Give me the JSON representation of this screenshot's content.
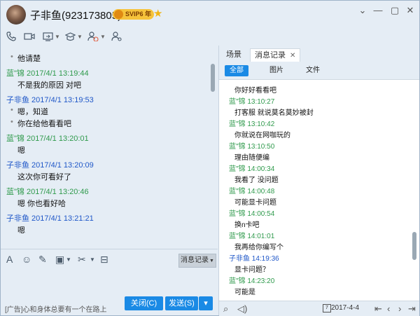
{
  "window": {
    "title": "子非鱼(923173805)",
    "svip_badge": "SVIP6 年",
    "controls": [
      "⌄",
      "—",
      "▢",
      "✕"
    ]
  },
  "toolbar": {
    "icons": [
      "phone-icon",
      "video-icon",
      "screen-share-icon",
      "app-center-icon",
      "add-contact-icon",
      "more-user-icon"
    ]
  },
  "chat": {
    "messages": [
      {
        "type": "body",
        "text": "他请楚",
        "dot": true
      },
      {
        "type": "head",
        "color": "green",
        "text": "蓝\"锦 2017/4/1 13:19:44"
      },
      {
        "type": "body",
        "text": "不是我的原因 对吧",
        "dot": false
      },
      {
        "type": "head",
        "color": "blue",
        "text": "子非鱼 2017/4/1 13:19:53"
      },
      {
        "type": "body",
        "text": "嗯，知道",
        "dot": true
      },
      {
        "type": "body",
        "text": "你在给他看看吧",
        "dot": true
      },
      {
        "type": "head",
        "color": "green",
        "text": "蓝\"锦 2017/4/1 13:20:01"
      },
      {
        "type": "body",
        "text": "嗯",
        "dot": false
      },
      {
        "type": "head",
        "color": "blue",
        "text": "子非鱼 2017/4/1 13:20:09"
      },
      {
        "type": "body",
        "text": "这次你可看好了",
        "dot": false
      },
      {
        "type": "head",
        "color": "green",
        "text": "蓝\"锦 2017/4/1 13:20:46"
      },
      {
        "type": "body",
        "text": "嗯 你也看好哈",
        "dot": false
      },
      {
        "type": "head",
        "color": "blue",
        "text": "子非鱼 2017/4/1 13:21:21"
      },
      {
        "type": "body",
        "text": "嗯",
        "dot": false
      }
    ]
  },
  "input": {
    "record_button": "消息记录",
    "ad_text": "[广告]心和身体总要有一个在路上",
    "close_button": "关闭(C)",
    "send_button": "发送(S)"
  },
  "right_panel": {
    "tabs": [
      "场景",
      "消息记录"
    ],
    "filters": [
      "全部",
      "图片",
      "文件"
    ],
    "history": [
      {
        "type": "body",
        "text": "你好好看看吧"
      },
      {
        "type": "head",
        "color": "green",
        "text": "蓝\"锦 13:10:27"
      },
      {
        "type": "body",
        "text": "打客服 就说莫名莫妙被封"
      },
      {
        "type": "head",
        "color": "green",
        "text": "蓝\"锦 13:10:42"
      },
      {
        "type": "body",
        "text": "你就说在网咖玩的"
      },
      {
        "type": "head",
        "color": "green",
        "text": "蓝\"锦 13:10:50"
      },
      {
        "type": "body",
        "text": "理由随便编"
      },
      {
        "type": "head",
        "color": "green",
        "text": "蓝\"锦 14:00:34"
      },
      {
        "type": "body",
        "text": "我看了 没问题"
      },
      {
        "type": "head",
        "color": "green",
        "text": "蓝\"锦 14:00:48"
      },
      {
        "type": "body",
        "text": "可能显卡问题"
      },
      {
        "type": "head",
        "color": "green",
        "text": "蓝\"锦 14:00:54"
      },
      {
        "type": "body",
        "text": "换n卡吧"
      },
      {
        "type": "head",
        "color": "green",
        "text": "蓝\"锦 14:01:01"
      },
      {
        "type": "body",
        "text": "我再给你编写个"
      },
      {
        "type": "head",
        "color": "blue",
        "text": "子非鱼 14:19:36"
      },
      {
        "type": "body",
        "text": "显卡问题？"
      },
      {
        "type": "head",
        "color": "green",
        "text": "蓝\"锦 14:23:20"
      },
      {
        "type": "body",
        "text": "可能是"
      }
    ],
    "date": "2017-4-4",
    "calendar_day": "7"
  }
}
